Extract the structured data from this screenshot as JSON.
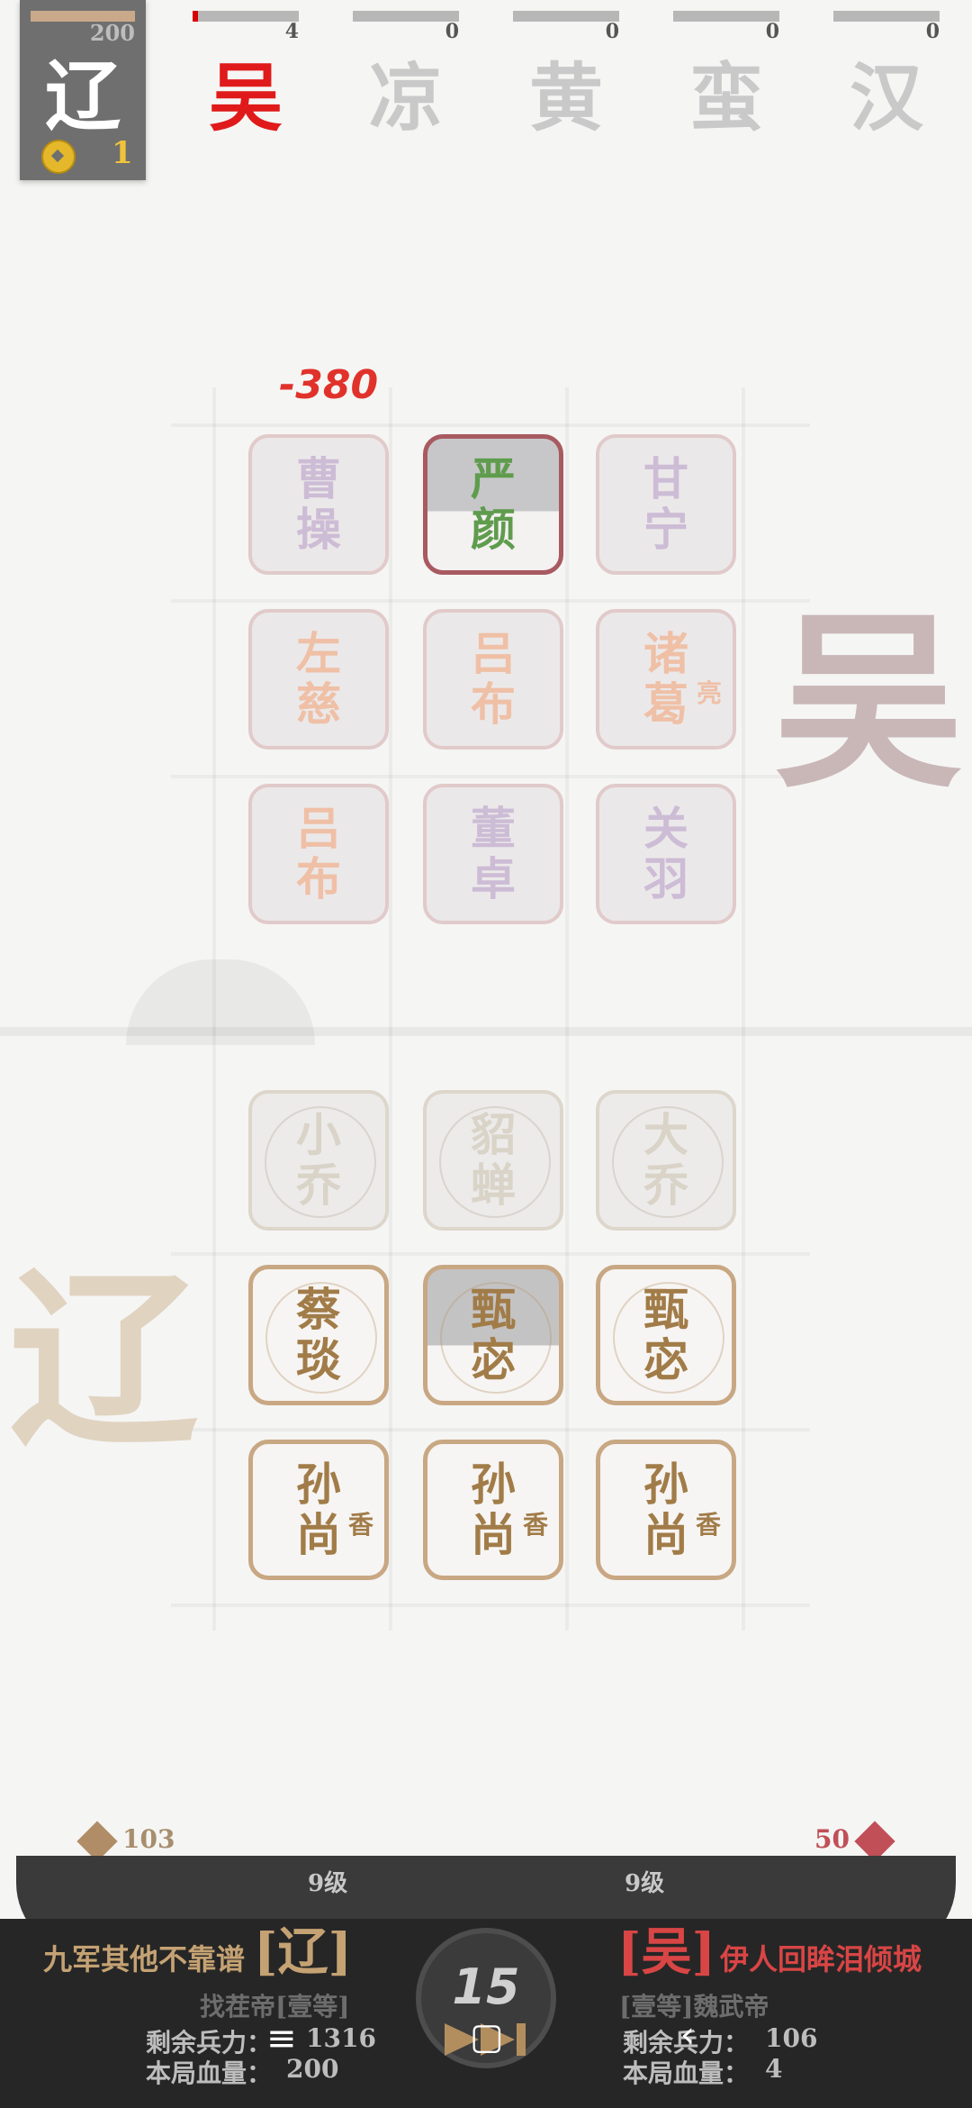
{
  "player": {
    "faction_glyph": "辽",
    "hp": "200",
    "coins": "1"
  },
  "factions": [
    {
      "name": "吴",
      "count": "4",
      "active": true,
      "fill": 0.05
    },
    {
      "name": "凉",
      "count": "0",
      "active": false,
      "fill": 0
    },
    {
      "name": "黄",
      "count": "0",
      "active": false,
      "fill": 0
    },
    {
      "name": "蛮",
      "count": "0",
      "active": false,
      "fill": 0
    },
    {
      "name": "汉",
      "count": "0",
      "active": false,
      "fill": 0
    }
  ],
  "damage_popup": "-380",
  "enemy_watermark": "吴",
  "player_watermark": "辽",
  "enemy_tiles": [
    {
      "l1": "曹",
      "l2": "操",
      "sub": ""
    },
    {
      "l1": "严",
      "l2": "颜",
      "sub": ""
    },
    {
      "l1": "甘",
      "l2": "宁",
      "sub": ""
    },
    {
      "l1": "左",
      "l2": "慈",
      "sub": ""
    },
    {
      "l1": "吕",
      "l2": "布",
      "sub": ""
    },
    {
      "l1": "诸",
      "l2": "葛",
      "sub": "亮"
    },
    {
      "l1": "吕",
      "l2": "布",
      "sub": ""
    },
    {
      "l1": "董",
      "l2": "卓",
      "sub": ""
    },
    {
      "l1": "关",
      "l2": "羽",
      "sub": ""
    }
  ],
  "player_tiles": [
    {
      "l1": "小",
      "l2": "乔",
      "sub": ""
    },
    {
      "l1": "貂",
      "l2": "蝉",
      "sub": ""
    },
    {
      "l1": "大",
      "l2": "乔",
      "sub": ""
    },
    {
      "l1": "蔡",
      "l2": "琰",
      "sub": ""
    },
    {
      "l1": "甄",
      "l2": "宓",
      "sub": ""
    },
    {
      "l1": "甄",
      "l2": "宓",
      "sub": ""
    },
    {
      "l1": "孙",
      "l2": "尚",
      "sub": "香"
    },
    {
      "l1": "孙",
      "l2": "尚",
      "sub": "香"
    },
    {
      "l1": "孙",
      "l2": "尚",
      "sub": "香"
    }
  ],
  "bottom": {
    "left_troops": "103",
    "right_troops": "50",
    "left_level": "9级",
    "right_level": "9级",
    "left_title": "九军其他不靠谱",
    "left_tag": "[辽]",
    "right_tag": "[吴]",
    "right_title": "伊人回眸泪倾城",
    "left_rank": "找茬帝[壹等]",
    "right_rank": "[壹等]魏武帝",
    "left_remaining_label": "剩余兵力：",
    "left_remaining": "1316",
    "left_hp_label": "本局血量：",
    "left_hp": "200",
    "right_remaining_label": "剩余兵力：",
    "right_remaining": "106",
    "right_hp_label": "本局血量：",
    "right_hp": "4",
    "round": "15"
  },
  "nav": {
    "menu_icon": "≡",
    "home_icon": "▢",
    "back_icon": "‹"
  }
}
